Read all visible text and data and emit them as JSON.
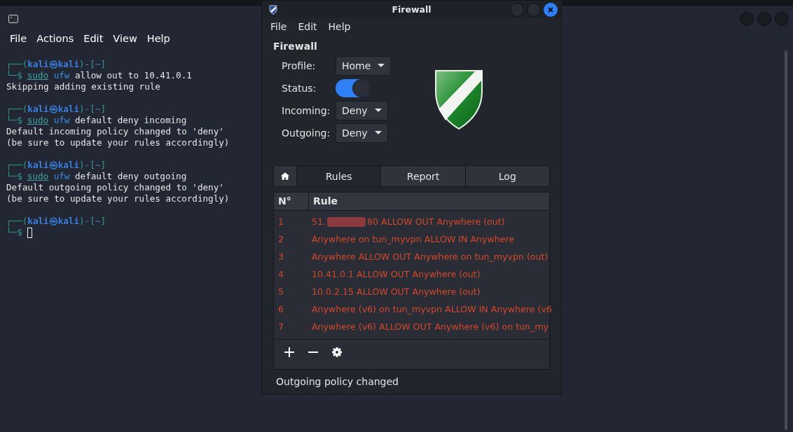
{
  "terminal": {
    "menu": [
      "File",
      "Actions",
      "Edit",
      "View",
      "Help"
    ],
    "blocks": [
      {
        "prompt": {
          "open": "┌──(",
          "user": "kali",
          "at": "㉿",
          "host": "kali",
          "mid": ")-[",
          "dir": "~",
          "close": "]",
          "symbol": "└─$"
        },
        "command": {
          "tool": "sudo",
          "program": "ufw",
          "args": "allow out to 10.41.0.1"
        },
        "output": [
          "Skipping adding existing rule"
        ]
      },
      {
        "prompt": {
          "open": "┌──(",
          "user": "kali",
          "at": "㉿",
          "host": "kali",
          "mid": ")-[",
          "dir": "~",
          "close": "]",
          "symbol": "└─$"
        },
        "command": {
          "tool": "sudo",
          "program": "ufw",
          "args": "default deny incoming"
        },
        "output": [
          "Default incoming policy changed to 'deny'",
          "(be sure to update your rules accordingly)"
        ]
      },
      {
        "prompt": {
          "open": "┌──(",
          "user": "kali",
          "at": "㉿",
          "host": "kali",
          "mid": ")-[",
          "dir": "~",
          "close": "]",
          "symbol": "└─$"
        },
        "command": {
          "tool": "sudo",
          "program": "ufw",
          "args": "default deny outgoing"
        },
        "output": [
          "Default outgoing policy changed to 'deny'",
          "(be sure to update your rules accordingly)"
        ]
      },
      {
        "prompt": {
          "open": "┌──(",
          "user": "kali",
          "at": "㉿",
          "host": "kali",
          "mid": ")-[",
          "dir": "~",
          "close": "]",
          "symbol": "└─$"
        },
        "cursor": true
      }
    ]
  },
  "firewall": {
    "title": "Firewall",
    "menu": [
      "File",
      "Edit",
      "Help"
    ],
    "heading": "Firewall",
    "fields": [
      {
        "kind": "dropdown",
        "label": "Profile:",
        "value": "Home"
      },
      {
        "kind": "switch",
        "label": "Status:",
        "on": true
      },
      {
        "kind": "dropdown",
        "label": "Incoming:",
        "value": "Deny"
      },
      {
        "kind": "dropdown",
        "label": "Outgoing:",
        "value": "Deny"
      }
    ],
    "tabs": [
      {
        "label": "Rules",
        "selected": true
      },
      {
        "label": "Report",
        "selected": false
      },
      {
        "label": "Log",
        "selected": false
      }
    ],
    "table": {
      "columns": [
        "N°",
        "Rule"
      ],
      "rows": [
        {
          "number": "1",
          "rule_start": "51.",
          "redacted": true,
          "rule": "80 ALLOW OUT Anywhere (out)"
        },
        {
          "number": "2",
          "rule": "Anywhere on tun_myvpn ALLOW IN Anywhere"
        },
        {
          "number": "3",
          "rule": "Anywhere ALLOW OUT Anywhere on tun_myvpn (out)"
        },
        {
          "number": "4",
          "rule": "10.41.0.1 ALLOW OUT Anywhere (out)"
        },
        {
          "number": "5",
          "rule": "10.0.2.15 ALLOW OUT Anywhere (out)"
        },
        {
          "number": "6",
          "rule": "Anywhere (v6) on tun_myvpn ALLOW IN Anywhere (v6"
        },
        {
          "number": "7",
          "rule": "Anywhere (v6) ALLOW OUT Anywhere (v6) on tun_my"
        }
      ]
    },
    "status_bar": "Outgoing policy changed"
  }
}
